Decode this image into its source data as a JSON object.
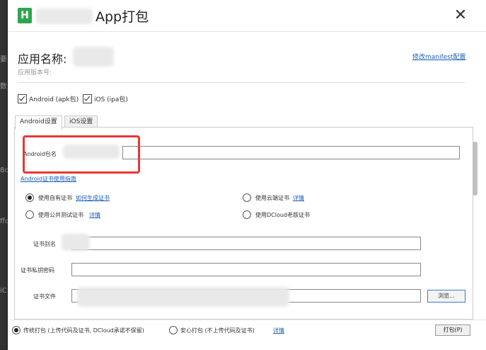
{
  "window": {
    "title": "App打包",
    "logo_letter": "H"
  },
  "app": {
    "name_label": "应用名称:",
    "version_label": "应用版本号:"
  },
  "manifest_link": "修改manifest配置",
  "targets": [
    {
      "label": "Android (apk包)",
      "checked": true
    },
    {
      "label": "iOS (ipa包)",
      "checked": true
    }
  ],
  "tabs": [
    "Android设置",
    "iOS设置"
  ],
  "android": {
    "package_label": "Android包名",
    "cert_guide_link": "Android证书使用指南",
    "options": [
      {
        "label": "使用自有证书",
        "link": "如何生成证书",
        "selected": true
      },
      {
        "label": "使用云端证书",
        "link": "详情",
        "selected": false
      },
      {
        "label": "使用公共测试证书",
        "link": "详情",
        "selected": false
      },
      {
        "label": "使用DCloud老版证书",
        "link": "",
        "selected": false
      }
    ],
    "alias_label": "证书别名",
    "password_label": "证书私钥密码",
    "file_label": "证书文件",
    "browse_label": "浏览..."
  },
  "footer": {
    "mode1": "传统打包 (上传代码及证书, DCloud承诺不保留)",
    "mode2": "安心打包 (不上传代码及证书)",
    "detail_link": "详情",
    "pack_button": "打包(P)",
    "selected_mode": 1
  },
  "background_text": [
    "要",
    "数",
    "8c",
    "ffd",
    "iC"
  ]
}
